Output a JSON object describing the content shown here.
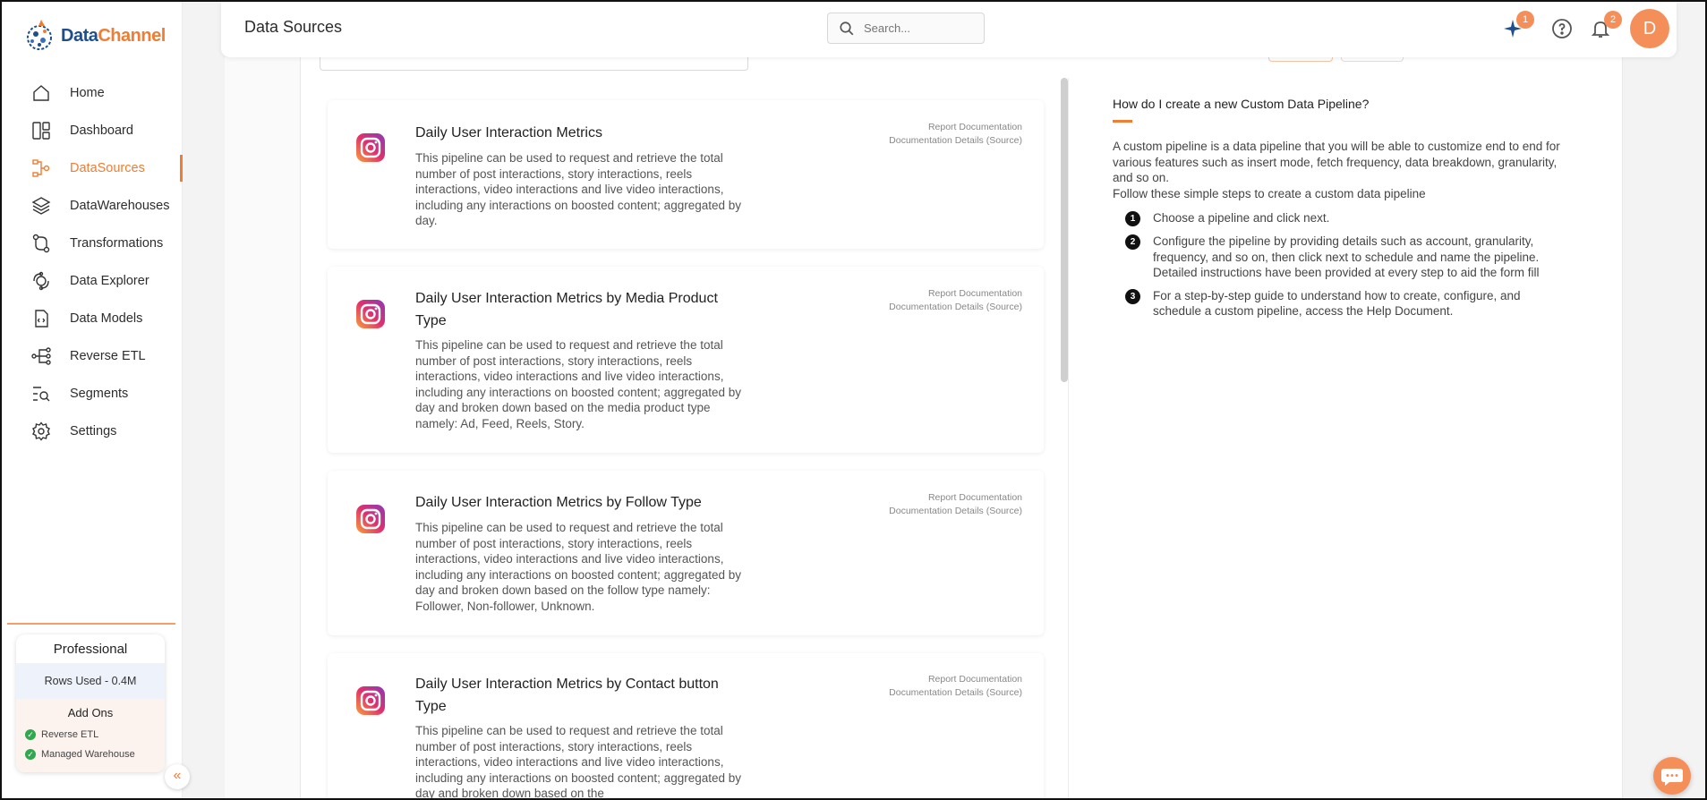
{
  "app": {
    "logo_part1": "Data",
    "logo_part2": "Channel",
    "accent": "#ef7d34"
  },
  "header": {
    "title": "Data Sources",
    "search_placeholder": "Search...",
    "ai_badge": "1",
    "notif_badge": "2",
    "avatar_initial": "D"
  },
  "sidebar": {
    "items": [
      {
        "label": "Home",
        "icon": "home-icon"
      },
      {
        "label": "Dashboard",
        "icon": "dashboard-icon"
      },
      {
        "label": "DataSources",
        "icon": "datasources-icon",
        "active": true
      },
      {
        "label": "DataWarehouses",
        "icon": "layers-icon"
      },
      {
        "label": "Transformations",
        "icon": "transform-icon"
      },
      {
        "label": "Data Explorer",
        "icon": "explorer-icon"
      },
      {
        "label": "Data Models",
        "icon": "data-model-icon"
      },
      {
        "label": "Reverse ETL",
        "icon": "reverse-etl-icon"
      },
      {
        "label": "Segments",
        "icon": "segments-icon"
      },
      {
        "label": "Settings",
        "icon": "gear-icon"
      }
    ],
    "plan": {
      "name": "Professional",
      "rows_used": "Rows Used - 0.4M",
      "addons_title": "Add Ons",
      "addons": [
        "Reverse ETL",
        "Managed Warehouse"
      ]
    }
  },
  "pipelines": [
    {
      "title": "Daily User Interaction Metrics",
      "description": "This pipeline can be used to request and retrieve the total number of post interactions, story interactions, reels interactions, video interactions and live video interactions, including any interactions on boosted content; aggregated by day.",
      "link1": "Report Documentation",
      "link2": "Documentation Details (Source)"
    },
    {
      "title": "Daily User Interaction Metrics by Media Product Type",
      "description": "This pipeline can be used to request and retrieve the total number of post interactions, story interactions, reels interactions, video interactions and live video interactions, including any interactions on boosted content; aggregated by day and broken down based on the media product type namely: Ad, Feed, Reels, Story.",
      "link1": "Report Documentation",
      "link2": "Documentation Details (Source)"
    },
    {
      "title": "Daily User Interaction Metrics by Follow Type",
      "description": "This pipeline can be used to request and retrieve the total number of post interactions, story interactions, reels interactions, video interactions and live video interactions, including any interactions on boosted content; aggregated by day and broken down based on the follow type namely: Follower, Non-follower, Unknown.",
      "link1": "Report Documentation",
      "link2": "Documentation Details (Source)"
    },
    {
      "title": "Daily User Interaction Metrics by Contact button Type",
      "description": "This pipeline can be used to request and retrieve the total number of post interactions, story interactions, reels interactions, video interactions and live video interactions, including any interactions on boosted content; aggregated by day and broken down based on the",
      "link1": "Report Documentation",
      "link2": "Documentation Details (Source)"
    }
  ],
  "help": {
    "title": "How do I create a new Custom Data Pipeline?",
    "intro": "A custom pipeline is a data pipeline that you will be able to customize end to end for various features such as insert mode, fetch frequency, data breakdown, granularity, and so on.",
    "intro2": "Follow these simple steps to create a custom data pipeline",
    "steps": [
      {
        "num": "1",
        "text": "Choose a pipeline and click next."
      },
      {
        "num": "2",
        "text": "Configure the pipeline by providing details such as account, granularity, frequency, and so on, then click next to schedule and name the pipeline. Detailed instructions have been provided at every step to aid the form fill"
      },
      {
        "num": "3",
        "text": "For a step-by-step guide to understand how to create, configure, and schedule a custom pipeline, access the Help Document."
      }
    ]
  }
}
